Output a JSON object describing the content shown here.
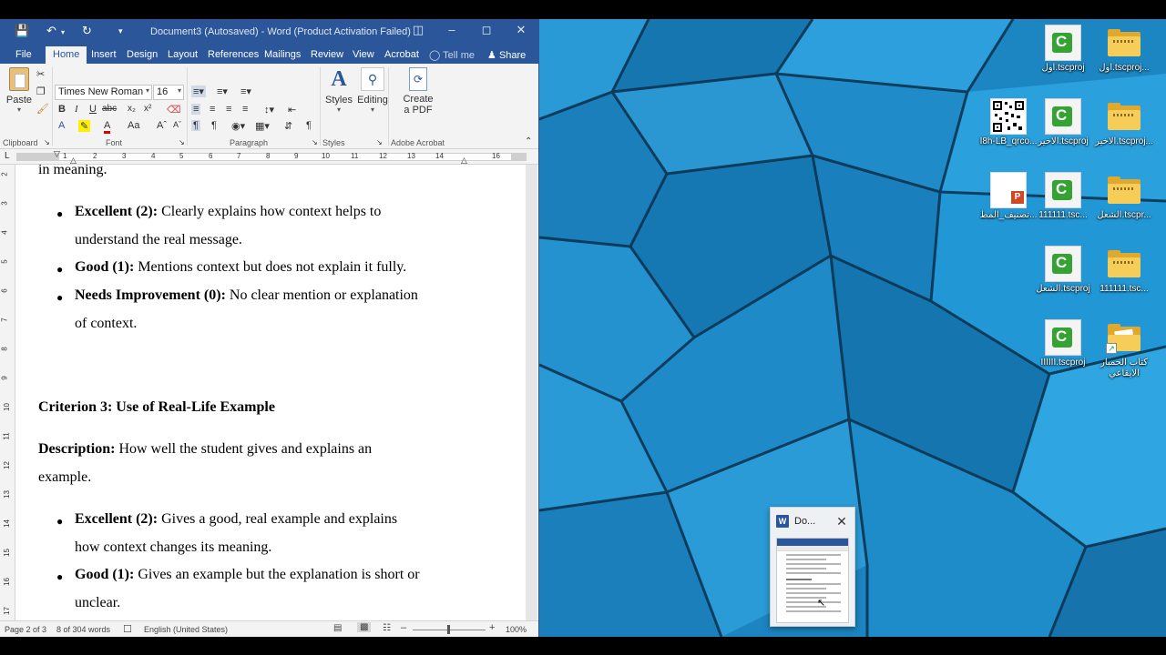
{
  "word": {
    "title": "Document3 (Autosaved) - Word (Product Activation Failed)",
    "tabs": [
      "File",
      "Home",
      "Insert",
      "Design",
      "Layout",
      "References",
      "Mailings",
      "Review",
      "View",
      "Acrobat"
    ],
    "tell_me": "Tell me",
    "share": "Share",
    "ribbon": {
      "paste": "Paste",
      "font_name": "Times New Roman",
      "font_size": "16",
      "styles": "Styles",
      "editing": "Editing",
      "create_pdf_1": "Create",
      "create_pdf_2": "a PDF",
      "groups": {
        "clipboard": "Clipboard",
        "font": "Font",
        "paragraph": "Paragraph",
        "styles": "Styles",
        "adobe": "Adobe Acrobat"
      }
    },
    "ruler_numbers": [
      "1",
      "2",
      "3",
      "4",
      "5",
      "6",
      "7",
      "8",
      "9",
      "10",
      "11",
      "12",
      "13",
      "14",
      "16"
    ],
    "vruler_numbers": [
      "2",
      "3",
      "4",
      "5",
      "6",
      "7",
      "8",
      "9",
      "10",
      "11",
      "12",
      "13",
      "14",
      "15",
      "16",
      "17"
    ],
    "document": {
      "top_fragment": "in meaning.",
      "bullets_a": [
        {
          "bold": "Excellent (2):",
          "line1": " Clearly explains how context helps to",
          "line2": "understand the real message."
        },
        {
          "bold": "Good (1):",
          "line1": " Mentions context but does not explain it fully.",
          "line2": ""
        },
        {
          "bold": "Needs Improvement (0):",
          "line1": " No clear mention or explanation",
          "line2": "of context."
        }
      ],
      "heading": "Criterion 3: Use of Real-Life Example",
      "description_bold": "Description:",
      "description_line1": " How well the student gives and explains an",
      "description_line2": "example.",
      "bullets_b": [
        {
          "bold": "Excellent (2):",
          "line1": " Gives a good, real example and explains",
          "line2": "how context changes its meaning."
        },
        {
          "bold": "Good (1):",
          "line1": " Gives an example but the explanation is short or",
          "line2": "unclear."
        }
      ]
    },
    "status": {
      "page": "Page 2 of 3",
      "words": "8 of 304 words",
      "language": "English (United States)",
      "zoom": "100%"
    }
  },
  "desktop": {
    "icons": [
      {
        "label": "اول.tscproj",
        "type": "camtasia"
      },
      {
        "label": "اول.tscproj...",
        "type": "folder"
      },
      {
        "label": "I8h-LB_qrco...",
        "type": "qr"
      },
      {
        "label": "الاخير.tscproj",
        "type": "camtasia"
      },
      {
        "label": "الاخير.tscproj...",
        "type": "folder"
      },
      {
        "label": "تصنيف_المط...",
        "type": "ppt"
      },
      {
        "label": "111111.tsc...",
        "type": "camtasia"
      },
      {
        "label": "الشعل.tscpr...",
        "type": "folder"
      },
      {
        "label": "الشعل.tscproj",
        "type": "camtasia"
      },
      {
        "label": "111111.tsc...",
        "type": "folder"
      },
      {
        "label": "IIIIII.tscproj",
        "type": "camtasia"
      },
      {
        "label": "كتاب الحمبار الايقاعي",
        "type": "folder-doc"
      }
    ]
  },
  "thumbnail": {
    "title": "Do..."
  }
}
